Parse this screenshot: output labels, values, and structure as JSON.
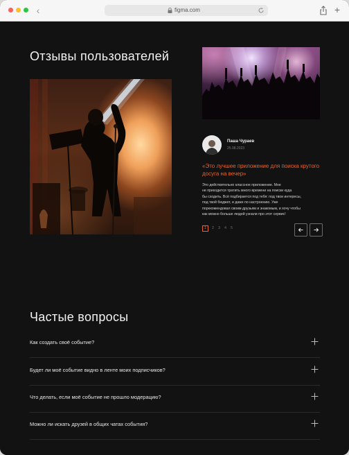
{
  "browser": {
    "url": "figma.com",
    "colors": {
      "close": "#ff5f57",
      "minimize": "#febc2e",
      "maximize": "#28c840"
    }
  },
  "reviews": {
    "title": "Отзывы пользователей",
    "author": {
      "name": "Паша Чураев",
      "date": "25.08.2023"
    },
    "quote": "«Это лучшее приложение для поиска крутого досуга на вечер»",
    "body_lines": [
      "Это действительно классное приложение. Мне",
      "не приходится тратить много времени на поиски куда",
      "бы сходить. Всё подбирается под тебя: под твои интересы,",
      "под твой бюджет, и даже по настроению. Уже",
      "порекомендовал своим друзьям и знакомым, и хочу чтобы",
      "как можно больше людей узнали про этот сервис!"
    ],
    "pages": [
      "1",
      "2",
      "3",
      "4",
      "5"
    ],
    "active_page": "1",
    "prev_icon": "arrow-left-icon",
    "next_icon": "arrow-right-icon",
    "accent": "#e8632d"
  },
  "faq": {
    "title": "Частые вопросы",
    "items": [
      "Как создать своё событие?",
      "Будет ли моё событие видно в ленте моих подписчиков?",
      "Что делать, если моё событие не прошло модерацию?",
      "Можно ли искать друзей в общих чатах события?"
    ],
    "expand_icon": "plus-icon"
  }
}
